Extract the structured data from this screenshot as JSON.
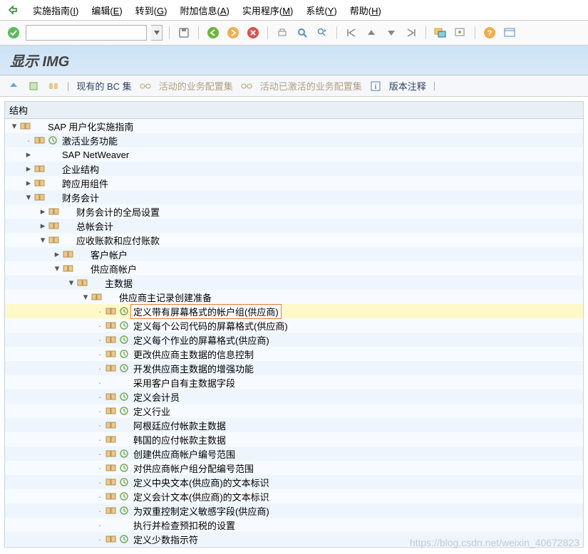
{
  "menubar": {
    "items": [
      {
        "label": "实施指南",
        "key": "I"
      },
      {
        "label": "编辑",
        "key": "E"
      },
      {
        "label": "转到",
        "key": "G"
      },
      {
        "label": "附加信息",
        "key": "A"
      },
      {
        "label": "实用程序",
        "key": "M"
      },
      {
        "label": "系统",
        "key": "Y"
      },
      {
        "label": "帮助",
        "key": "H"
      }
    ]
  },
  "title": "显示 IMG",
  "toolbar2": {
    "existing_bc_set": "现有的 BC 集",
    "active_bc_config": "活动的业务配置集",
    "activated_bc_config": "活动已激活的业务配置集",
    "version_notes": "版本注释"
  },
  "tree": {
    "header": "结构",
    "rows": [
      {
        "level": 0,
        "exp": "open",
        "node": true,
        "label": "SAP 用户化实施指南"
      },
      {
        "level": 1,
        "exp": "leaf",
        "node": true,
        "activity": true,
        "label": "激活业务功能"
      },
      {
        "level": 1,
        "exp": "closed",
        "node": false,
        "label": "SAP NetWeaver"
      },
      {
        "level": 1,
        "exp": "closed",
        "node": true,
        "label": "企业结构"
      },
      {
        "level": 1,
        "exp": "closed",
        "node": true,
        "label": "跨应用组件"
      },
      {
        "level": 1,
        "exp": "open",
        "node": true,
        "label": "财务会计"
      },
      {
        "level": 2,
        "exp": "closed",
        "node": true,
        "label": "财务会计的全局设置"
      },
      {
        "level": 2,
        "exp": "closed",
        "node": true,
        "label": "总帐会计"
      },
      {
        "level": 2,
        "exp": "open",
        "node": true,
        "label": "应收账款和应付账款"
      },
      {
        "level": 3,
        "exp": "closed",
        "node": true,
        "label": "客户帐户"
      },
      {
        "level": 3,
        "exp": "open",
        "node": true,
        "label": "供应商帐户"
      },
      {
        "level": 4,
        "exp": "open",
        "node": true,
        "label": "主数据"
      },
      {
        "level": 5,
        "exp": "open",
        "node": true,
        "label": "供应商主记录创建准备"
      },
      {
        "level": 6,
        "exp": "leaf",
        "node": true,
        "activity": true,
        "selected": true,
        "label": "定义带有屏幕格式的帐户组(供应商)"
      },
      {
        "level": 6,
        "exp": "leaf",
        "node": true,
        "activity": true,
        "label": "定义每个公司代码的屏幕格式(供应商)"
      },
      {
        "level": 6,
        "exp": "leaf",
        "node": true,
        "activity": true,
        "label": "定义每个作业的屏幕格式(供应商)"
      },
      {
        "level": 6,
        "exp": "leaf",
        "node": true,
        "activity": true,
        "label": "更改供应商主数据的信息控制"
      },
      {
        "level": 6,
        "exp": "leaf",
        "node": true,
        "activity": true,
        "label": "开发供应商主数据的增强功能"
      },
      {
        "level": 6,
        "exp": "leaf",
        "node": false,
        "label": "采用客户自有主数据字段"
      },
      {
        "level": 6,
        "exp": "leaf",
        "node": true,
        "activity": true,
        "label": "定义会计员"
      },
      {
        "level": 6,
        "exp": "leaf",
        "node": true,
        "activity": true,
        "label": "定义行业"
      },
      {
        "level": 6,
        "exp": "leaf",
        "node": true,
        "label": "阿根廷应付帐款主数据"
      },
      {
        "level": 6,
        "exp": "leaf",
        "node": true,
        "label": "韩国的应付帐款主数据"
      },
      {
        "level": 6,
        "exp": "leaf",
        "node": true,
        "activity": true,
        "label": "创建供应商帐户编号范围"
      },
      {
        "level": 6,
        "exp": "leaf",
        "node": true,
        "activity": true,
        "label": "对供应商帐户组分配编号范围"
      },
      {
        "level": 6,
        "exp": "leaf",
        "node": true,
        "activity": true,
        "label": "定义中央文本(供应商)的文本标识"
      },
      {
        "level": 6,
        "exp": "leaf",
        "node": true,
        "activity": true,
        "label": "定义会计文本(供应商)的文本标识"
      },
      {
        "level": 6,
        "exp": "leaf",
        "node": true,
        "activity": true,
        "label": "为双重控制定义敏感字段(供应商)"
      },
      {
        "level": 6,
        "exp": "leaf",
        "node": false,
        "label": "执行并检查预扣税的设置"
      },
      {
        "level": 6,
        "exp": "leaf",
        "node": true,
        "activity": true,
        "label": "定义少数指示符"
      }
    ]
  },
  "watermark": "https://blog.csdn.net/weixin_40672823"
}
